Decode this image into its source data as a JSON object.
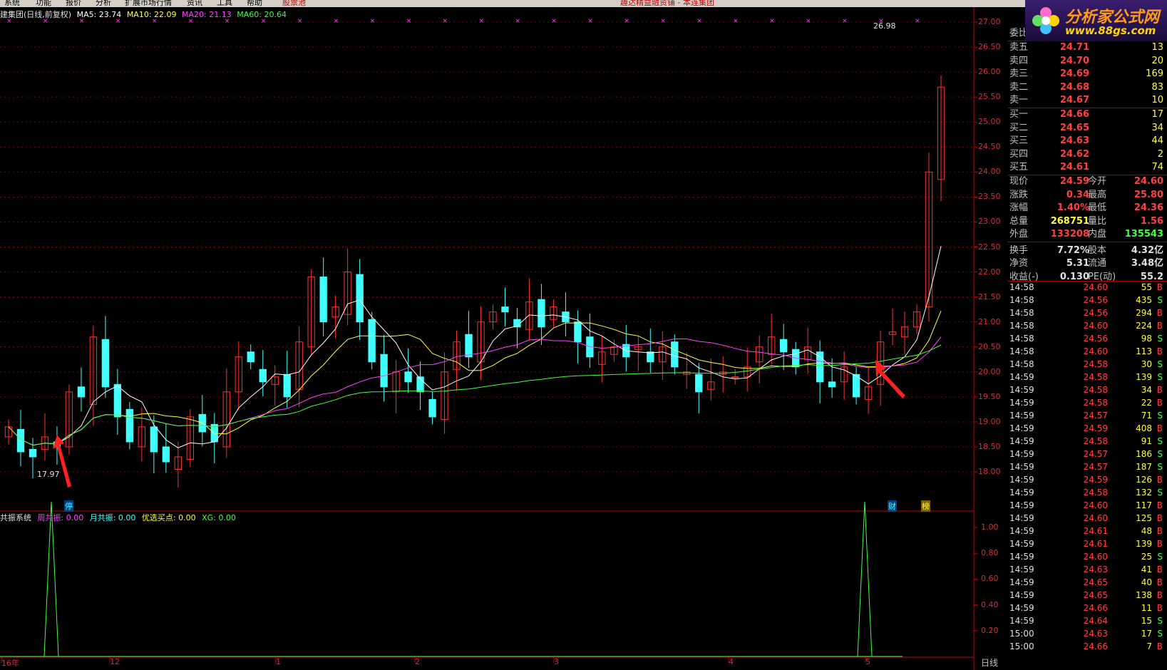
{
  "menu": {
    "items": [
      "系统",
      "功能",
      "报价",
      "分析",
      "扩展市场行情",
      "资讯",
      "工具",
      "帮助"
    ],
    "highlight": "股票池",
    "center_text": "趣达精益融资铺 - 本连集团"
  },
  "title_bar": {
    "stock": "建集团(日线,前复权)",
    "ma": [
      {
        "label": "MA5: 23.74",
        "color": "#ffffff"
      },
      {
        "label": "MA10: 22.09",
        "color": "#ffff40"
      },
      {
        "label": "MA20: 21.13",
        "color": "#ff40ff"
      },
      {
        "label": "MA60: 20.64",
        "color": "#40ff40"
      }
    ]
  },
  "indicator": {
    "name": "共振系统",
    "fields": [
      {
        "label": "周共振: 0.00",
        "color": "#ff40ff"
      },
      {
        "label": "月共振: 0.00",
        "color": "#40ffff"
      },
      {
        "label": "优选买点: 0.00",
        "color": "#ffff40"
      },
      {
        "label": "XG: 0.00",
        "color": "#40ff40"
      }
    ],
    "ticks": [
      "1.00",
      "0.80",
      "0.60",
      "0.40",
      "0.20"
    ]
  },
  "price_axis": [
    "27.00",
    "26.50",
    "26.00",
    "25.50",
    "25.00",
    "24.50",
    "24.00",
    "23.50",
    "23.00",
    "22.50",
    "22.00",
    "21.50",
    "21.00",
    "20.50",
    "20.00",
    "19.50",
    "19.00",
    "18.50",
    "18.00"
  ],
  "date_axis": [
    "16年",
    "12",
    "1",
    "2",
    "3",
    "4",
    "5"
  ],
  "annotations": {
    "high": "26.98",
    "low": "17.97",
    "tag_stop": "停",
    "tag_fin": "财",
    "tag_rank": "榜"
  },
  "period": "日线",
  "logo": {
    "title": "分析家公式网",
    "url": "www.88gs.com"
  },
  "book": {
    "header": "委比",
    "sell": [
      {
        "label": "卖五",
        "price": "24.71",
        "vol": "13"
      },
      {
        "label": "卖四",
        "price": "24.70",
        "vol": "20"
      },
      {
        "label": "卖三",
        "price": "24.69",
        "vol": "169"
      },
      {
        "label": "卖二",
        "price": "24.68",
        "vol": "83"
      },
      {
        "label": "卖一",
        "price": "24.67",
        "vol": "10"
      }
    ],
    "buy": [
      {
        "label": "买一",
        "price": "24.66",
        "vol": "17"
      },
      {
        "label": "买二",
        "price": "24.65",
        "vol": "34"
      },
      {
        "label": "买三",
        "price": "24.63",
        "vol": "44"
      },
      {
        "label": "买四",
        "price": "24.62",
        "vol": "2"
      },
      {
        "label": "买五",
        "price": "24.61",
        "vol": "74"
      }
    ]
  },
  "stats": [
    {
      "l": "现价",
      "v": "24.59",
      "l2": "今开",
      "v2": "24.60",
      "c": "#ff4040",
      "c2": "#ff4040"
    },
    {
      "l": "涨跌",
      "v": "0.34",
      "l2": "最高",
      "v2": "25.80",
      "c": "#ff4040",
      "c2": "#ff4040"
    },
    {
      "l": "涨幅",
      "v": "1.40%",
      "l2": "最低",
      "v2": "24.36",
      "c": "#ff4040",
      "c2": "#ff4040"
    },
    {
      "l": "总量",
      "v": "268751",
      "l2": "量比",
      "v2": "1.56",
      "c": "#ffff40",
      "c2": "#ff4040"
    },
    {
      "l": "外盘",
      "v": "133208",
      "l2": "内盘",
      "v2": "135543",
      "c": "#ff4040",
      "c2": "#40ff40"
    },
    {
      "l": "换手",
      "v": "7.72%",
      "l2": "股本",
      "v2": "4.32亿",
      "c": "#e0e0e0",
      "c2": "#e0e0e0"
    },
    {
      "l": "净资",
      "v": "5.31",
      "l2": "流通",
      "v2": "3.48亿",
      "c": "#e0e0e0",
      "c2": "#e0e0e0"
    },
    {
      "l": "收益(-)",
      "v": "0.130",
      "l2": "PE(动)",
      "v2": "55.2",
      "c": "#e0e0e0",
      "c2": "#e0e0e0"
    }
  ],
  "ticks_list": [
    [
      "14:58",
      "24.60",
      "55",
      "B"
    ],
    [
      "14:58",
      "24.56",
      "435",
      "S"
    ],
    [
      "14:58",
      "24.56",
      "294",
      "B"
    ],
    [
      "14:58",
      "24.60",
      "224",
      "B"
    ],
    [
      "14:58",
      "24.56",
      "98",
      "S"
    ],
    [
      "14:58",
      "24.60",
      "113",
      "B"
    ],
    [
      "14:58",
      "24.58",
      "30",
      "S"
    ],
    [
      "14:59",
      "24.58",
      "139",
      "S"
    ],
    [
      "14:59",
      "24.58",
      "34",
      "B"
    ],
    [
      "14:59",
      "24.58",
      "22",
      "B"
    ],
    [
      "14:59",
      "24.57",
      "71",
      "S"
    ],
    [
      "14:59",
      "24.59",
      "408",
      "B"
    ],
    [
      "14:59",
      "24.58",
      "91",
      "S"
    ],
    [
      "14:59",
      "24.57",
      "186",
      "S"
    ],
    [
      "14:59",
      "24.57",
      "187",
      "S"
    ],
    [
      "14:59",
      "24.59",
      "126",
      "B"
    ],
    [
      "14:59",
      "24.58",
      "132",
      "S"
    ],
    [
      "14:59",
      "24.60",
      "117",
      "B"
    ],
    [
      "14:59",
      "24.60",
      "125",
      "B"
    ],
    [
      "14:59",
      "24.61",
      "48",
      "B"
    ],
    [
      "14:59",
      "24.61",
      "139",
      "B"
    ],
    [
      "14:59",
      "24.60",
      "25",
      "S"
    ],
    [
      "14:59",
      "24.63",
      "41",
      "B"
    ],
    [
      "14:59",
      "24.65",
      "40",
      "B"
    ],
    [
      "14:59",
      "24.65",
      "138",
      "B"
    ],
    [
      "14:59",
      "24.66",
      "11",
      "B"
    ],
    [
      "14:59",
      "24.64",
      "15",
      "S"
    ],
    [
      "15:00",
      "24.63",
      "17",
      "S"
    ],
    [
      "15:00",
      "24.66",
      "7",
      "B"
    ]
  ],
  "colors": {
    "up": "#ff3030",
    "down": "#40ffff",
    "grid": "#800000",
    "buy": "#ff4040",
    "sell": "#40ff40"
  },
  "chart_data": {
    "type": "candlestick",
    "ma_close": [
      18.9,
      18.4,
      18.3,
      18.7,
      18.5,
      19.6,
      19.5,
      20.7,
      19.7,
      19.1,
      18.6,
      18.9,
      18.4,
      18.2,
      18.3,
      19.1,
      18.8,
      18.6,
      19.6,
      20.3,
      20.2,
      19.8,
      19.9,
      19.5,
      20.6,
      21.9,
      21.0,
      21.3,
      22.0,
      21.0,
      20.2,
      19.7,
      20.0,
      19.8,
      19.6,
      19.1,
      20.0,
      20.6,
      20.3,
      21.0,
      21.2,
      21.2,
      20.9,
      21.4,
      20.9,
      21.3,
      21.0,
      20.6,
      20.3,
      20.4,
      20.5,
      20.3,
      20.5,
      20.2,
      20.5,
      20.1,
      20.0,
      19.6,
      19.8,
      20.0,
      19.9,
      20.1,
      20.5,
      20.7,
      20.4,
      20.1,
      20.5,
      19.8,
      19.7,
      20.1,
      19.5,
      19.7,
      20.6,
      20.8,
      20.9,
      21.2,
      24.0,
      25.7
    ]
  }
}
